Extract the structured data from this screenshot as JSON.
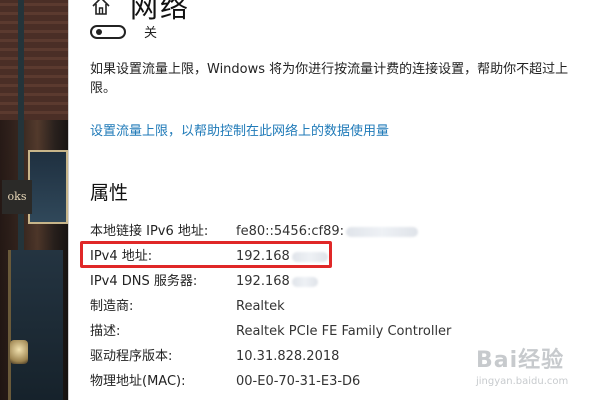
{
  "header": {
    "title": "网络"
  },
  "metered": {
    "toggle_state": "off",
    "toggle_label": "关",
    "description": "如果设置流量上限，Windows 将为你进行按流量计费的连接设置，帮助你不超过上限。",
    "link": "设置流量上限，以帮助控制在此网络上的数据使用量"
  },
  "properties": {
    "title": "属性",
    "rows": [
      {
        "label": "本地链接 IPv6 地址:",
        "value": "fe80::5456:cf89:"
      },
      {
        "label": "IPv4 地址:",
        "value": "192.168"
      },
      {
        "label": "IPv4 DNS 服务器:",
        "value": "192.168"
      },
      {
        "label": "制造商:",
        "value": "Realtek"
      },
      {
        "label": "描述:",
        "value": "Realtek PCIe FE Family Controller"
      },
      {
        "label": "驱动程序版本:",
        "value": "10.31.828.2018"
      },
      {
        "label": "物理地址(MAC):",
        "value": "00-E0-70-31-E3-D6"
      }
    ]
  },
  "wallpaper": {
    "sign_text": "oks"
  },
  "watermark": {
    "logo": "Bai经验",
    "url": "jingyan.baidu.com"
  },
  "colors": {
    "link": "#1f7ab8",
    "highlight": "#e02828"
  },
  "icons": {
    "home": "home-icon"
  }
}
